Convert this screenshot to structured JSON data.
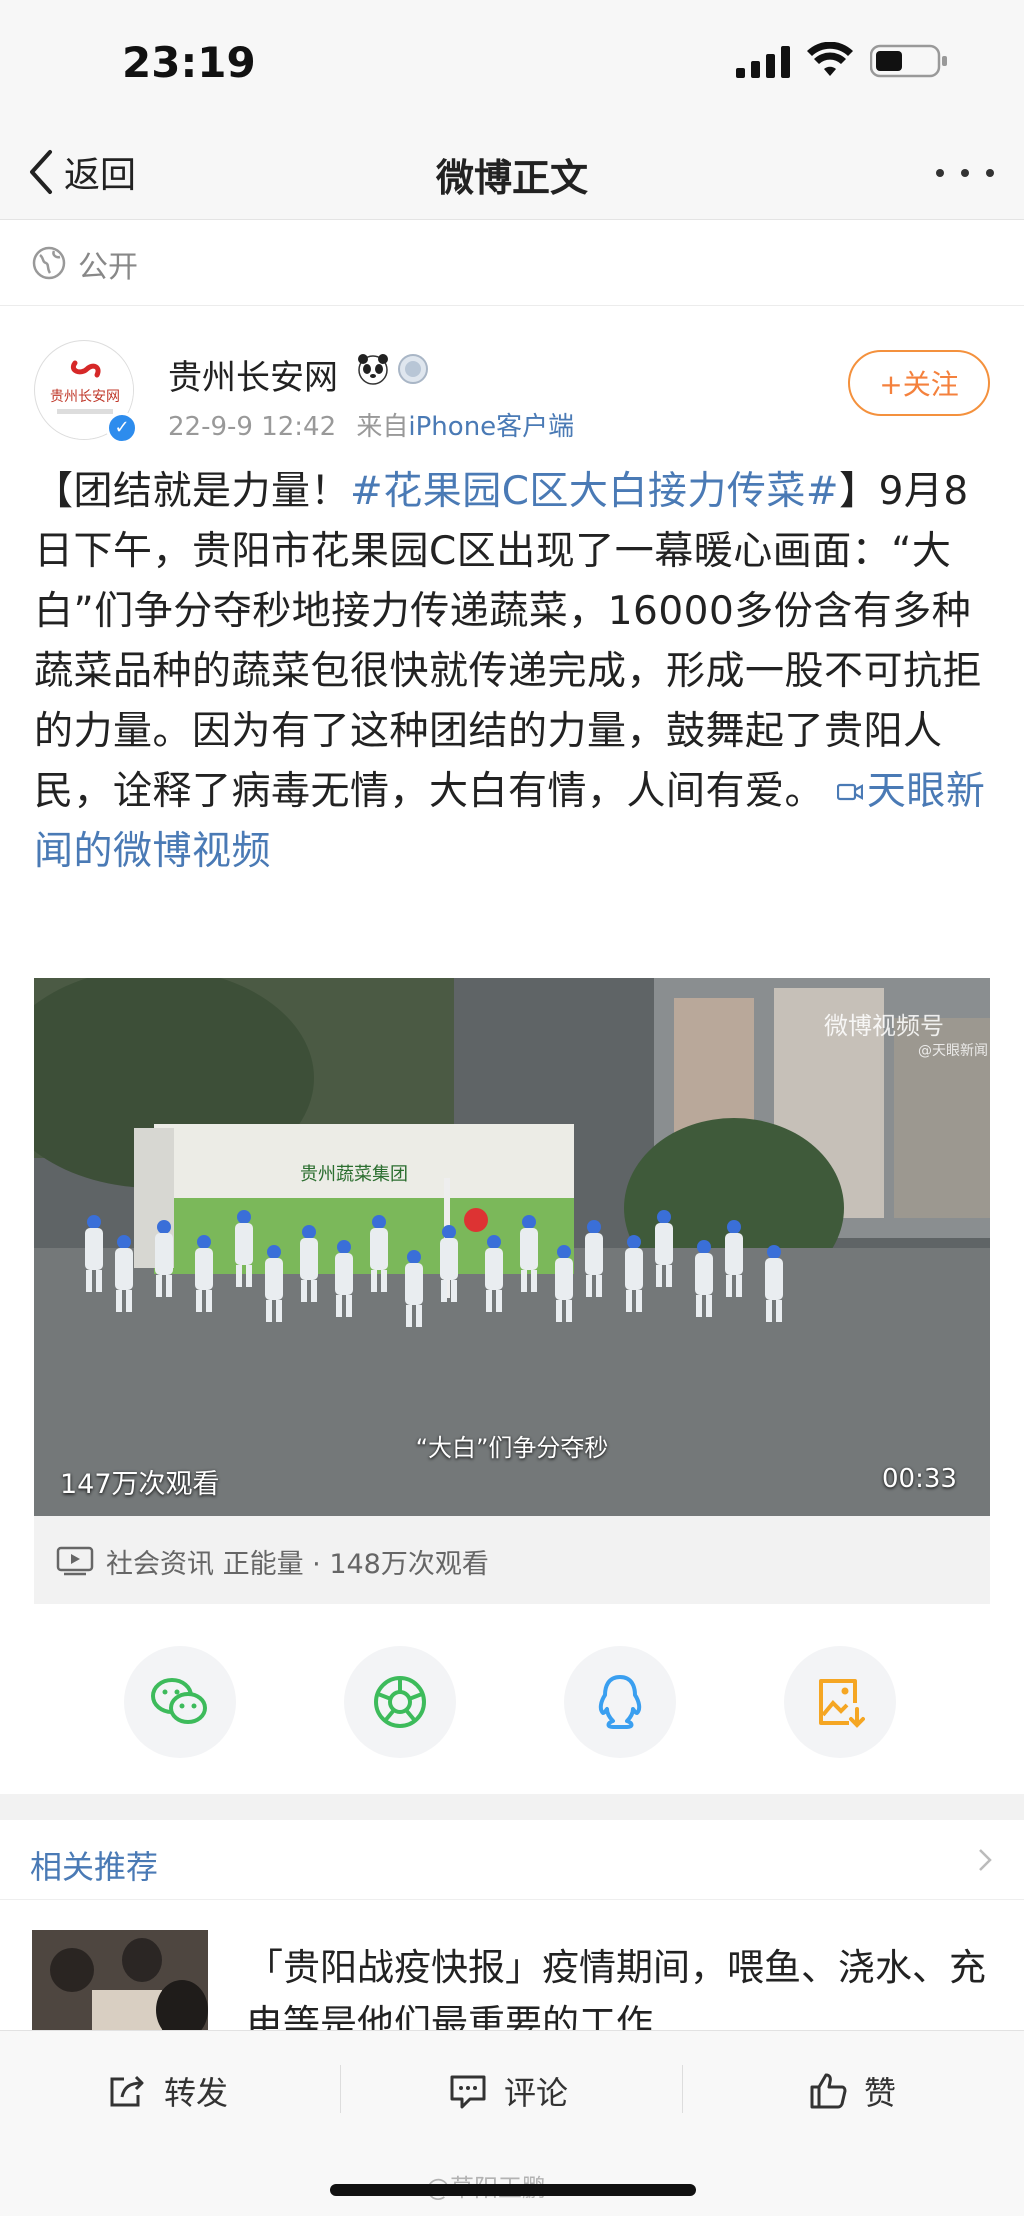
{
  "status_bar": {
    "time": "23:19"
  },
  "nav": {
    "back_label": "返回",
    "title": "微博正文"
  },
  "visibility": {
    "label": "公开"
  },
  "post": {
    "author": {
      "name": "贵州长安网",
      "avatar_text": "贵州长安网",
      "verified": true
    },
    "date": "22-9-9 12:42",
    "source_prefix": "来自",
    "source": "iPhone客户端",
    "follow_label": "+关注",
    "text_parts": [
      {
        "t": "【团结就是力量！",
        "k": "plain"
      },
      {
        "t": "#花果园C区大白接力传菜#",
        "k": "tag"
      },
      {
        "t": "】9月8日下午，贵阳市花果园C区出现了一幕暖心画面：“大白”们争分夺秒地接力传递蔬菜，16000多份含有多种蔬菜品种的蔬菜包很快就传递完成，形成一股不可抗拒的力量。因为有了这种团结的力量，鼓舞起了贵阳人民，诠释了病毒无情，大白有情，人间有爱。 ",
        "k": "plain"
      },
      {
        "t": "天眼新闻的微博视频",
        "k": "link"
      }
    ],
    "video": {
      "watermark": "微博视频号",
      "watermark_sub": "@天眼新闻",
      "caption": "“大白”们争分夺秒",
      "views": "147万次观看",
      "duration": "00:33",
      "truck_text": "贵州蔬菜集团"
    },
    "video_info": "社会资讯 正能量 · 148万次观看"
  },
  "share": [
    {
      "name": "wechat",
      "color": "#3dbb5b"
    },
    {
      "name": "moments",
      "color": "#3dbb5b"
    },
    {
      "name": "qq",
      "color": "#3a9ff0"
    },
    {
      "name": "save-image",
      "color": "#f5a623"
    }
  ],
  "related": {
    "header": "相关推荐",
    "items": [
      {
        "title": "「贵阳战疫快报」疫情期间，喂鱼、浇水、充电等是他们最重要的工作"
      }
    ]
  },
  "bottom_bar": {
    "repost": "转发",
    "comment": "评论",
    "like": "赞"
  },
  "watermark": "@草阳王鹏"
}
